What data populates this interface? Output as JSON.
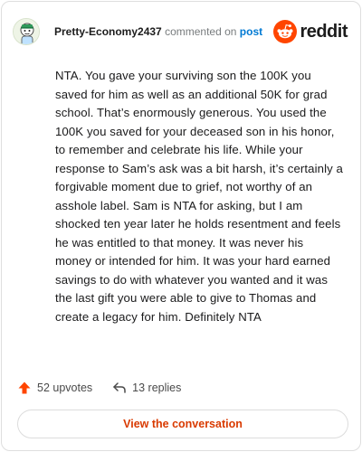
{
  "comment": {
    "username": "Pretty-Economy2437",
    "action_text": "commented on",
    "post_link": "post",
    "brand": "reddit",
    "body": "NTA. You gave your surviving son the 100K you saved for him as well as an additional 50K for grad school. That’s enormously generous. You used the 100K you saved for your deceased son in his honor, to remember and celebrate his life. While your response to Sam’s ask was a bit harsh, it’s certainly a forgivable moment due to grief, not worthy of an asshole label. Sam is NTA for asking, but I am shocked ten year later he holds resentment and feels he was entitled to that money. It was never his money or intended for him. It was your hard earned savings to do with whatever you wanted and it was the last gift you were able to give to Thomas and create a legacy for him. Definitely NTA"
  },
  "stats": {
    "upvotes": "52 upvotes",
    "replies": "13 replies"
  },
  "cta_label": "View the conversation",
  "colors": {
    "brand_orange": "#ff4500",
    "link_blue": "#0079d3",
    "cta_text": "#d93a00"
  },
  "icons": [
    "avatar",
    "reddit-logo-icon",
    "upvote-arrow-icon",
    "reply-arrow-icon"
  ]
}
